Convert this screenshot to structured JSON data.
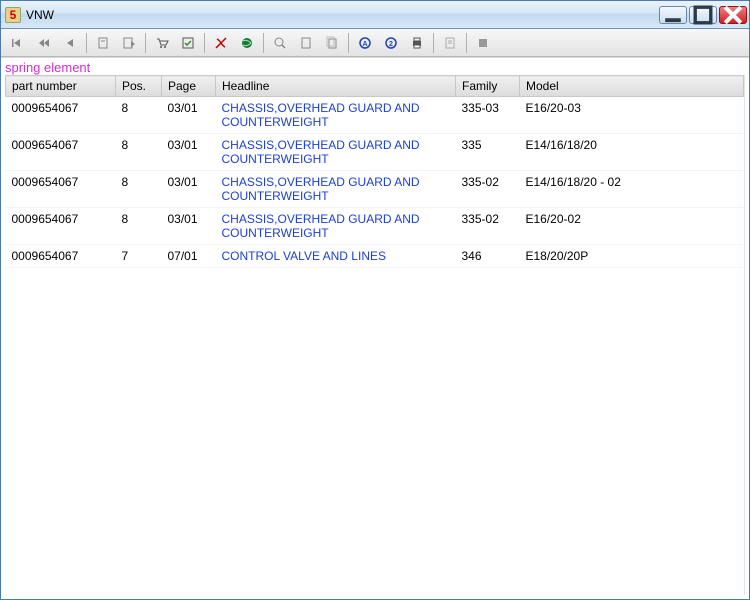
{
  "window": {
    "title": "VNW"
  },
  "section_title": "spring element",
  "columns": {
    "part_number": "part number",
    "pos": "Pos.",
    "page": "Page",
    "headline": "Headline",
    "family": "Family",
    "model": "Model"
  },
  "rows": [
    {
      "part_number": "0009654067",
      "pos": "8",
      "page": "03/01",
      "headline": "CHASSIS,OVERHEAD GUARD AND COUNTERWEIGHT",
      "family": "335-03",
      "model": "E16/20-03"
    },
    {
      "part_number": "0009654067",
      "pos": "8",
      "page": "03/01",
      "headline": "CHASSIS,OVERHEAD GUARD AND COUNTERWEIGHT",
      "family": "335",
      "model": "E14/16/18/20"
    },
    {
      "part_number": "0009654067",
      "pos": "8",
      "page": "03/01",
      "headline": "CHASSIS,OVERHEAD GUARD AND COUNTERWEIGHT",
      "family": "335-02",
      "model": "E14/16/18/20 - 02"
    },
    {
      "part_number": "0009654067",
      "pos": "8",
      "page": "03/01",
      "headline": "CHASSIS,OVERHEAD GUARD AND COUNTERWEIGHT",
      "family": "335-02",
      "model": "E16/20-02"
    },
    {
      "part_number": "0009654067",
      "pos": "7",
      "page": "07/01",
      "headline": "CONTROL VALVE AND LINES",
      "family": "346",
      "model": "E18/20/20P"
    }
  ],
  "toolbar_icons": {
    "first": "first-record",
    "fast_prev": "fast-previous",
    "prev": "previous",
    "bookmark_add": "bookmark-add",
    "bookmark_next": "bookmark-next",
    "cart": "cart",
    "checklist": "checklist",
    "history_off": "history-disabled",
    "globe": "globe",
    "zoom": "zoom",
    "doc1": "page",
    "doc2": "page-stack",
    "mark_a": "marker-a",
    "mark_b": "marker-b",
    "print": "print",
    "notes": "notes",
    "stop": "stop"
  }
}
